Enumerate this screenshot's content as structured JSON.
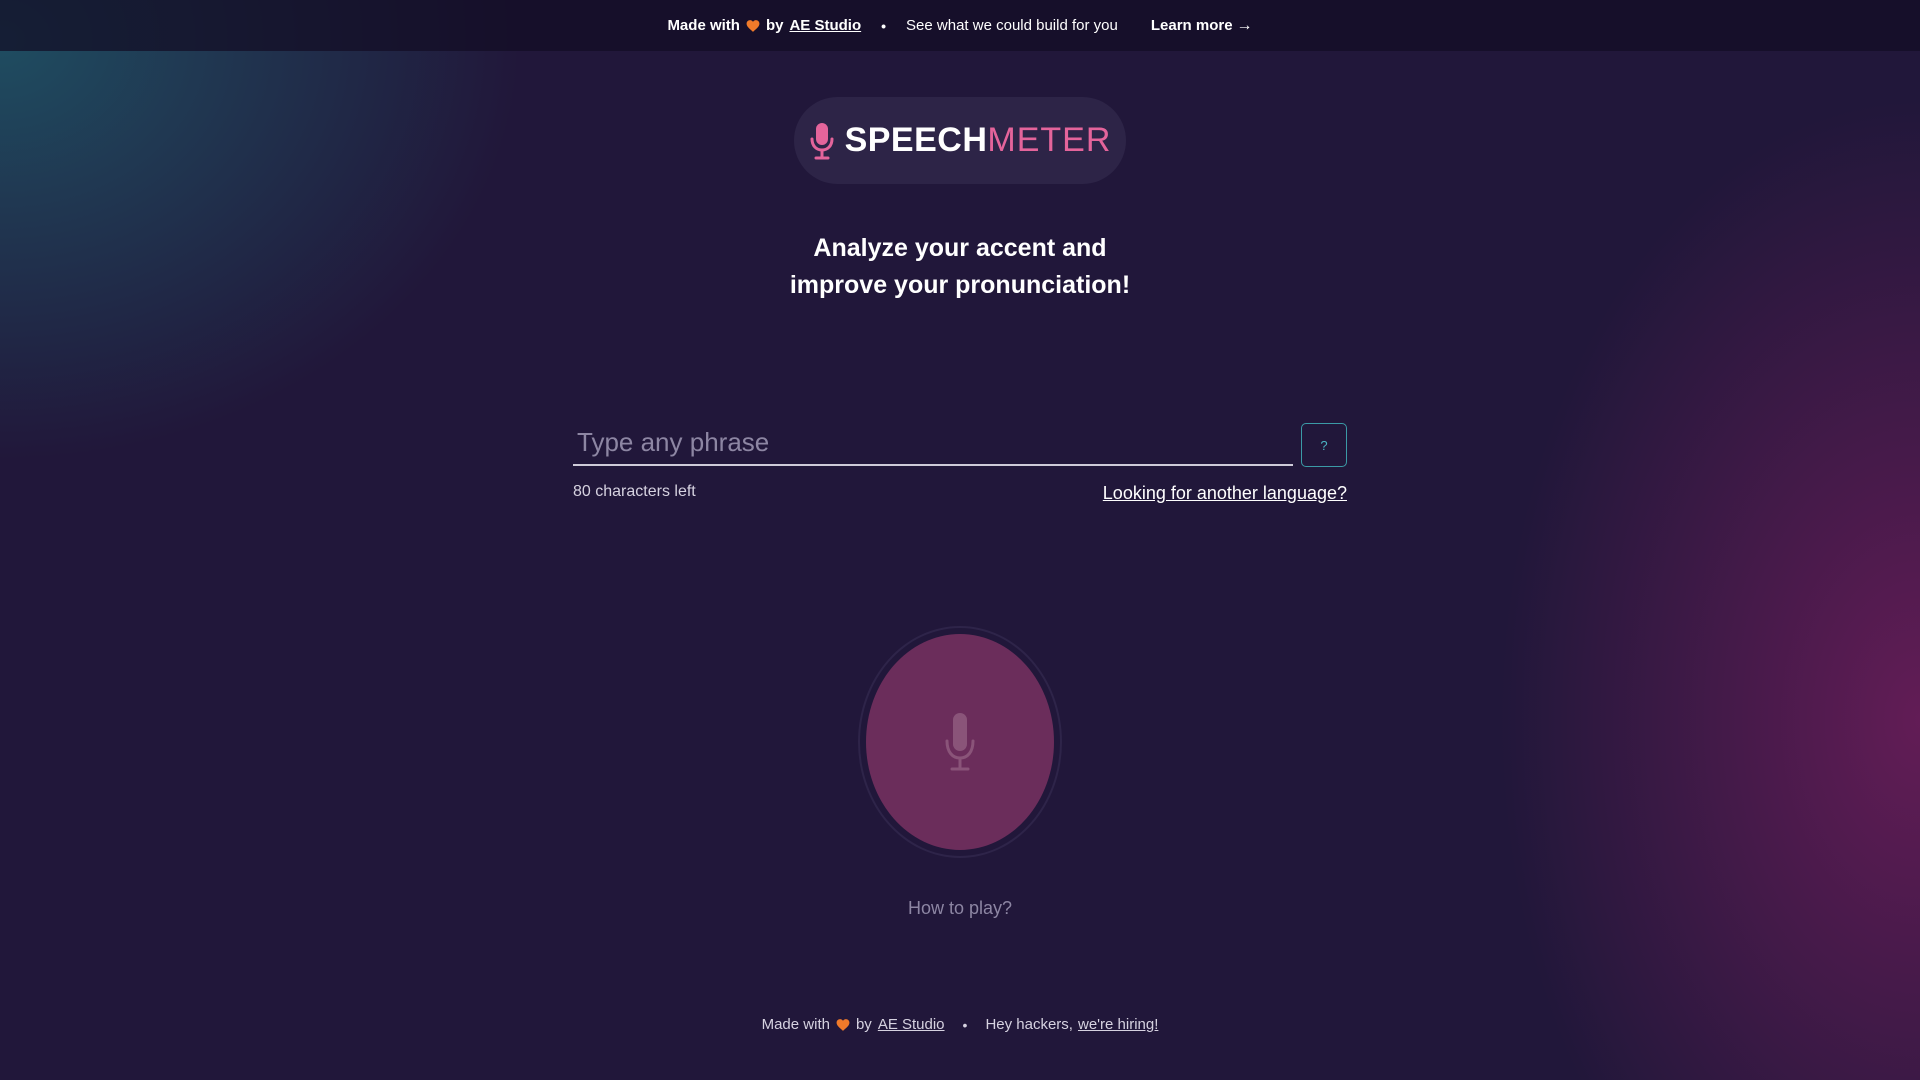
{
  "banner": {
    "made_with": "Made with",
    "by": "by",
    "studio": "AE Studio",
    "tagline": "See what we could build for you",
    "learn_more": "Learn more",
    "arrow": "→"
  },
  "logo": {
    "word_bold": "SPEECH",
    "word_light": "METER",
    "accent_color": "#e4649b"
  },
  "headline": {
    "line1": "Analyze your accent and",
    "line2": "improve your pronunciation!"
  },
  "phrase": {
    "placeholder": "Type any phrase",
    "value": "",
    "help_label": "?",
    "chars_left": "80 characters left",
    "language_link": "Looking for another language?"
  },
  "record": {
    "icon": "microphone-icon",
    "button_color": "#6b2d5b",
    "how_to_play": "How to play?"
  },
  "footer": {
    "made_with": "Made with",
    "by": "by",
    "studio": "AE Studio",
    "hey": "Hey hackers,",
    "hiring": "we're hiring!"
  },
  "colors": {
    "background": "#21173a",
    "heart": "#f07a2a",
    "help_border": "#3b9aa6"
  }
}
